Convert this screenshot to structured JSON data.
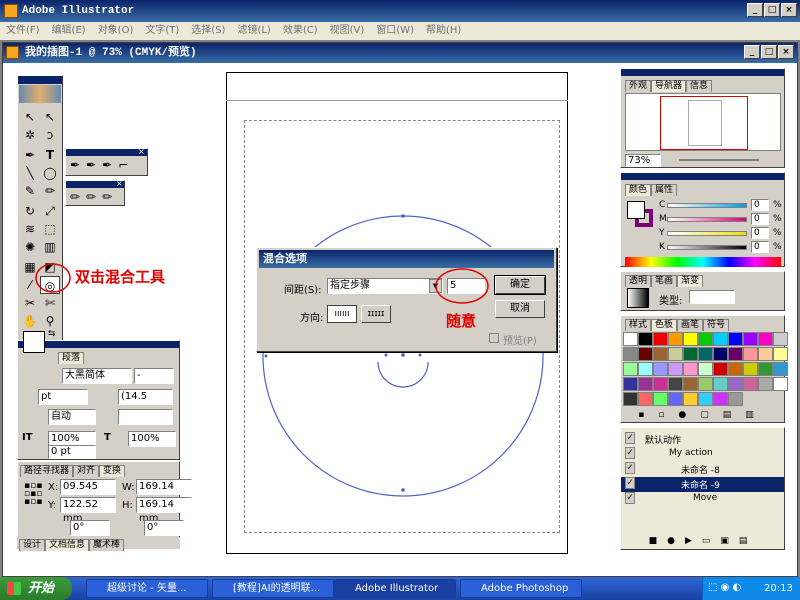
{
  "app": {
    "title": "Adobe Illustrator",
    "menu": [
      "文件(F)",
      "编辑(E)",
      "对象(O)",
      "文字(T)",
      "选择(S)",
      "滤镜(L)",
      "效果(C)",
      "视图(V)",
      "窗口(W)",
      "帮助(H)"
    ]
  },
  "doc": {
    "title": "我的插图-1 @ 73% (CMYK/预览)"
  },
  "dialog": {
    "title": "混合选项",
    "spacing_label": "间距(S):",
    "spacing_value": "指定步骤",
    "steps_value": "5",
    "orient_label": "方向:",
    "ok": "确定",
    "cancel": "取消",
    "preview": "预览(P)"
  },
  "annot": {
    "blend_tool": "双击混合工具",
    "random": "随意"
  },
  "nav": {
    "tabs": [
      "外观",
      "导航器",
      "信息"
    ],
    "zoom": "73%"
  },
  "color": {
    "tabs": [
      "颜色",
      "属性"
    ],
    "channels": [
      {
        "k": "C",
        "v": "0",
        "color": "#00a0e0"
      },
      {
        "k": "M",
        "v": "0",
        "color": "#e0007a"
      },
      {
        "k": "Y",
        "v": "0",
        "color": "#f0e000"
      },
      {
        "k": "K",
        "v": "0",
        "color": "#000000"
      }
    ],
    "pct": "%"
  },
  "gradient": {
    "tabs": [
      "透明",
      "笔画",
      "渐变"
    ],
    "type_label": "类型:"
  },
  "swatches": {
    "tabs": [
      "样式",
      "色板",
      "画笔",
      "符号"
    ]
  },
  "actions": {
    "rows": [
      "默认动作",
      "My action",
      "未命名 -8",
      "未命名 -9",
      "Move"
    ]
  },
  "char": {
    "tab": "段落",
    "font": "大黑简体",
    "style": "-",
    "size": "pt",
    "leading": "(14.5",
    "kern": "自动",
    "vscale": "100%",
    "hscale": "100%",
    "baseline": "0 pt"
  },
  "transform": {
    "tabs": [
      "路径寻找器",
      "对齐",
      "变换"
    ],
    "x_label": "X:",
    "x": "09.545 mm",
    "y_label": "Y:",
    "y": "122.52 mm",
    "w_label": "W:",
    "w": "169.14 mm",
    "h_label": "H:",
    "h": "169.14 mm",
    "angle": "0°",
    "shear": "0°"
  },
  "bottom_tabs": [
    "设计",
    "文档信息",
    "魔术棒"
  ],
  "taskbar": {
    "start": "开始",
    "items": [
      "超级讨论 - 矢量...",
      "[教程]AI的透明联...",
      "Adobe Illustrator",
      "Adobe Photoshop"
    ],
    "clock": "20:13"
  }
}
